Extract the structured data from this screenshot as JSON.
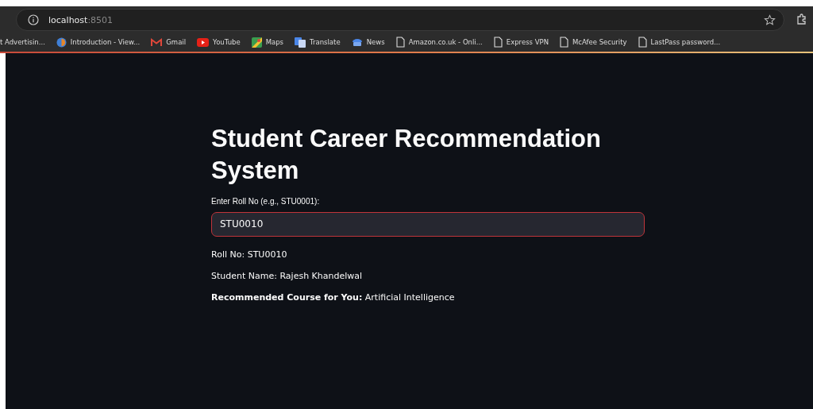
{
  "browser": {
    "address": {
      "host": "localhost",
      "port": ":8501"
    },
    "bookmarks": [
      {
        "label": "t Advertisin...",
        "kind": "none"
      },
      {
        "label": "Introduction - View...",
        "kind": "site"
      },
      {
        "label": "Gmail",
        "kind": "mail"
      },
      {
        "label": "YouTube",
        "kind": "video"
      },
      {
        "label": "Maps",
        "kind": "map"
      },
      {
        "label": "Translate",
        "kind": "translate"
      },
      {
        "label": "News",
        "kind": "news"
      },
      {
        "label": "Amazon.co.uk - Onli...",
        "kind": "page"
      },
      {
        "label": "Express VPN",
        "kind": "page"
      },
      {
        "label": "McAfee Security",
        "kind": "page"
      },
      {
        "label": "LastPass password...",
        "kind": "page"
      }
    ]
  },
  "page": {
    "title": "Student Career Recommendation System",
    "input": {
      "label": "Enter Roll No (e.g., STU0001):",
      "value": "STU0010",
      "focused": true
    },
    "results": [
      "Roll No: STU0010",
      "Student Name: Rajesh Khandelwal",
      "**Recommended Course for You:** Artificial Intelligence"
    ]
  }
}
